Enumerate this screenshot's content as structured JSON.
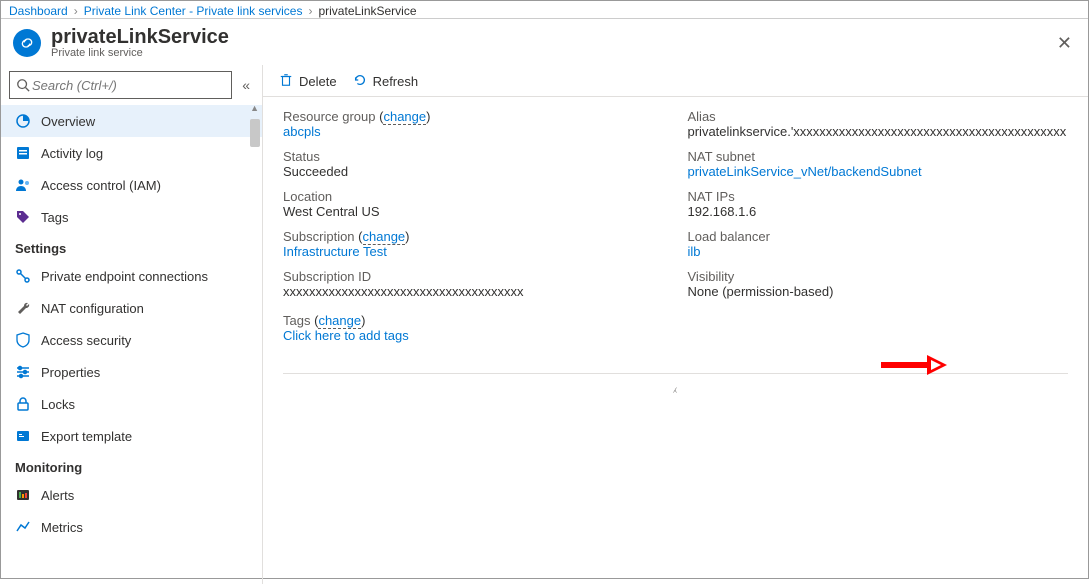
{
  "breadcrumb": [
    {
      "label": "Dashboard",
      "current": false
    },
    {
      "label": "Private Link Center - Private link services",
      "current": false
    },
    {
      "label": "privateLinkService",
      "current": true
    }
  ],
  "header": {
    "title": "privateLinkService",
    "subtitle": "Private link service"
  },
  "search": {
    "placeholder": "Search (Ctrl+/)"
  },
  "nav": {
    "top": [
      {
        "key": "overview",
        "label": "Overview",
        "icon": "overview"
      },
      {
        "key": "activity",
        "label": "Activity log",
        "icon": "log"
      },
      {
        "key": "iam",
        "label": "Access control (IAM)",
        "icon": "iam"
      },
      {
        "key": "tags",
        "label": "Tags",
        "icon": "tags"
      }
    ],
    "settings_heading": "Settings",
    "settings": [
      {
        "key": "pec",
        "label": "Private endpoint connections",
        "icon": "connections"
      },
      {
        "key": "nat",
        "label": "NAT configuration",
        "icon": "wrench"
      },
      {
        "key": "asec",
        "label": "Access security",
        "icon": "shield"
      },
      {
        "key": "props",
        "label": "Properties",
        "icon": "props"
      },
      {
        "key": "locks",
        "label": "Locks",
        "icon": "lock"
      },
      {
        "key": "export",
        "label": "Export template",
        "icon": "export"
      }
    ],
    "monitoring_heading": "Monitoring",
    "monitoring": [
      {
        "key": "alerts",
        "label": "Alerts",
        "icon": "alerts"
      },
      {
        "key": "metrics",
        "label": "Metrics",
        "icon": "metrics"
      }
    ]
  },
  "toolbar": {
    "delete": "Delete",
    "refresh": "Refresh"
  },
  "overview": {
    "left": {
      "resource_group_label": "Resource group",
      "change": "change",
      "resource_group": "abcpls",
      "status_label": "Status",
      "status": "Succeeded",
      "location_label": "Location",
      "location": "West Central US",
      "subscription_label": "Subscription",
      "subscription": "Infrastructure Test",
      "subscription_id_label": "Subscription ID",
      "subscription_id": "xxxxxxxxxxxxxxxxxxxxxxxxxxxxxxxxxxxxx",
      "tags_label": "Tags",
      "add_tags": "Click here to add tags"
    },
    "right": {
      "alias_label": "Alias",
      "alias": "privatelinkservice.'xxxxxxxxxxxxxxxxxxxxxxxxxxxxxxxxxxxxxxxxxx",
      "nat_subnet_label": "NAT subnet",
      "nat_subnet": "privateLinkService_vNet/backendSubnet",
      "nat_ips_label": "NAT IPs",
      "nat_ips": "192.168.1.6",
      "lb_label": "Load balancer",
      "lb": "ilb",
      "visibility_label": "Visibility",
      "visibility": "None (permission-based)"
    }
  }
}
